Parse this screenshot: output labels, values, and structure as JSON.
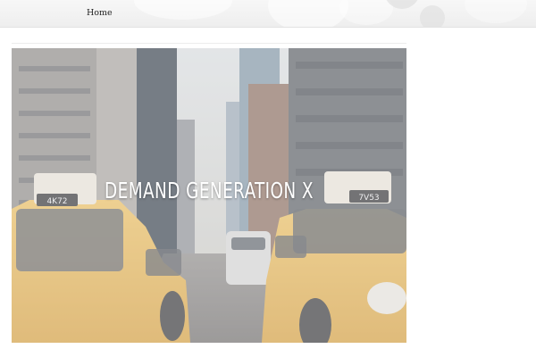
{
  "nav": {
    "home_label": "Home"
  },
  "hero": {
    "title": "DEMAND GENERATION X",
    "taxi_left_plate": "4K72",
    "taxi_right_plate": "7V53"
  },
  "colors": {
    "taxi_yellow": "#e8b64a",
    "overlay": "#ebebee",
    "nav_bar": "#f2f2f2"
  }
}
